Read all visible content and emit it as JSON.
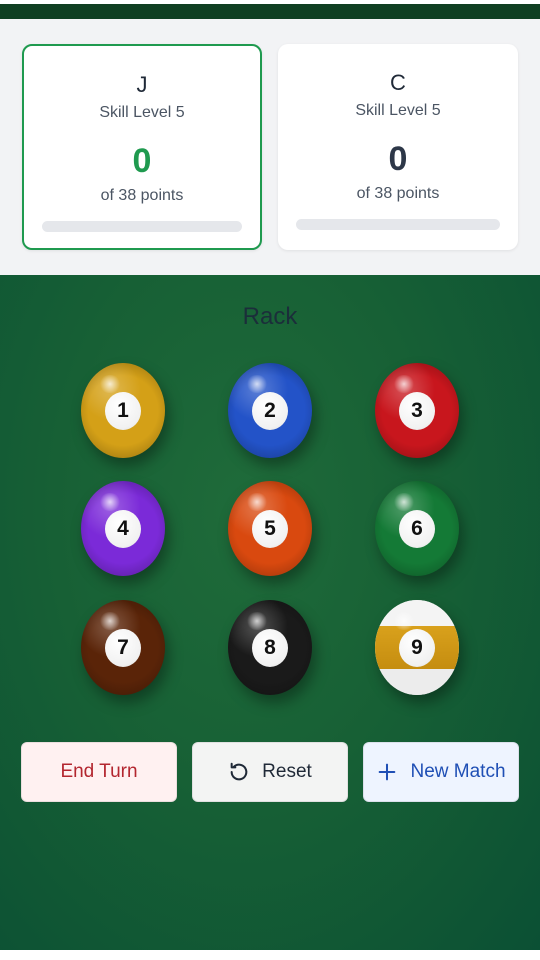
{
  "players": [
    {
      "name": "J",
      "skill": "Skill Level 5",
      "score": "0",
      "target": "of 38 points",
      "progress": 0,
      "active": true
    },
    {
      "name": "C",
      "skill": "Skill Level 5",
      "score": "0",
      "target": "of 38 points",
      "progress": 0,
      "active": false
    }
  ],
  "rack": {
    "title": "Rack",
    "balls": [
      {
        "label": "1",
        "color": "#d4a017",
        "stripe": false
      },
      {
        "label": "2",
        "color": "#2353c8",
        "stripe": false
      },
      {
        "label": "3",
        "color": "#c8161d",
        "stripe": false
      },
      {
        "label": "4",
        "color": "#7b2ad8",
        "stripe": false
      },
      {
        "label": "5",
        "color": "#d9490f",
        "stripe": false
      },
      {
        "label": "6",
        "color": "#147a36",
        "stripe": false
      },
      {
        "label": "7",
        "color": "#5a2408",
        "stripe": false
      },
      {
        "label": "8",
        "color": "#1a1a1a",
        "stripe": false
      },
      {
        "label": "9",
        "color": "#d9a11c",
        "stripe": true
      }
    ]
  },
  "actions": {
    "end_turn": "End Turn",
    "reset": "Reset",
    "new_match": "New Match"
  },
  "colors": {
    "felt": "#176035",
    "accent_green": "#1f9a4f",
    "end_turn": "#b3262f",
    "new_match": "#1f4fb5"
  },
  "icons": {
    "reset": "reset-icon",
    "new_match": "plus-icon"
  }
}
